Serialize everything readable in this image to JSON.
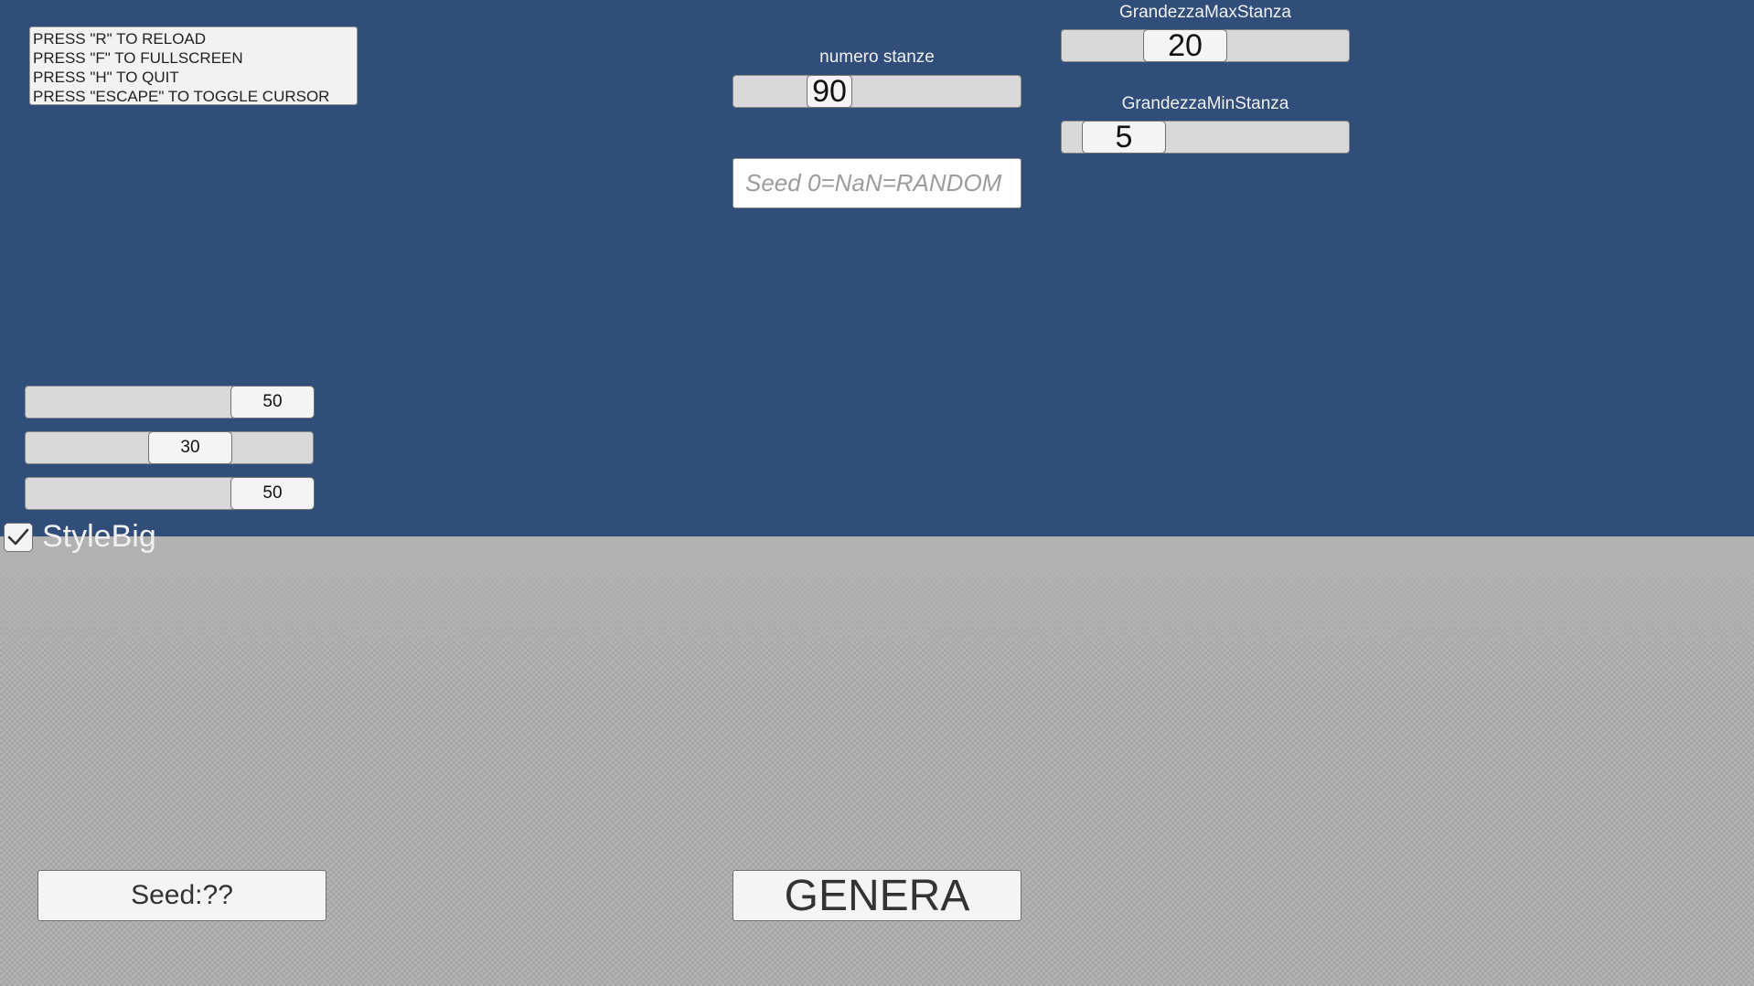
{
  "help": {
    "lines": [
      "PRESS \"R\" TO RELOAD",
      "PRESS \"F\" TO FULLSCREEN",
      "PRESS \"H\" TO QUIT",
      "PRESS \"ESCAPE\" TO TOGGLE CURSOR"
    ]
  },
  "numero_stanze": {
    "label": "numero stanze",
    "value": "90"
  },
  "grandezza_max": {
    "label": "GrandezzaMaxStanza",
    "value": "20"
  },
  "grandezza_min": {
    "label": "GrandezzaMinStanza",
    "value": "5"
  },
  "seed_input": {
    "placeholder": "Seed 0=NaN=RANDOM"
  },
  "left_sliders": [
    {
      "value": "50"
    },
    {
      "value": "30"
    },
    {
      "value": "50"
    }
  ],
  "style_big": {
    "label": "StyleBig",
    "checked": true
  },
  "seed_button": {
    "label": "Seed:??"
  },
  "genera_button": {
    "label": "GENERA"
  },
  "colors": {
    "sky": "#314d79",
    "ground": "#b3b3b3"
  }
}
